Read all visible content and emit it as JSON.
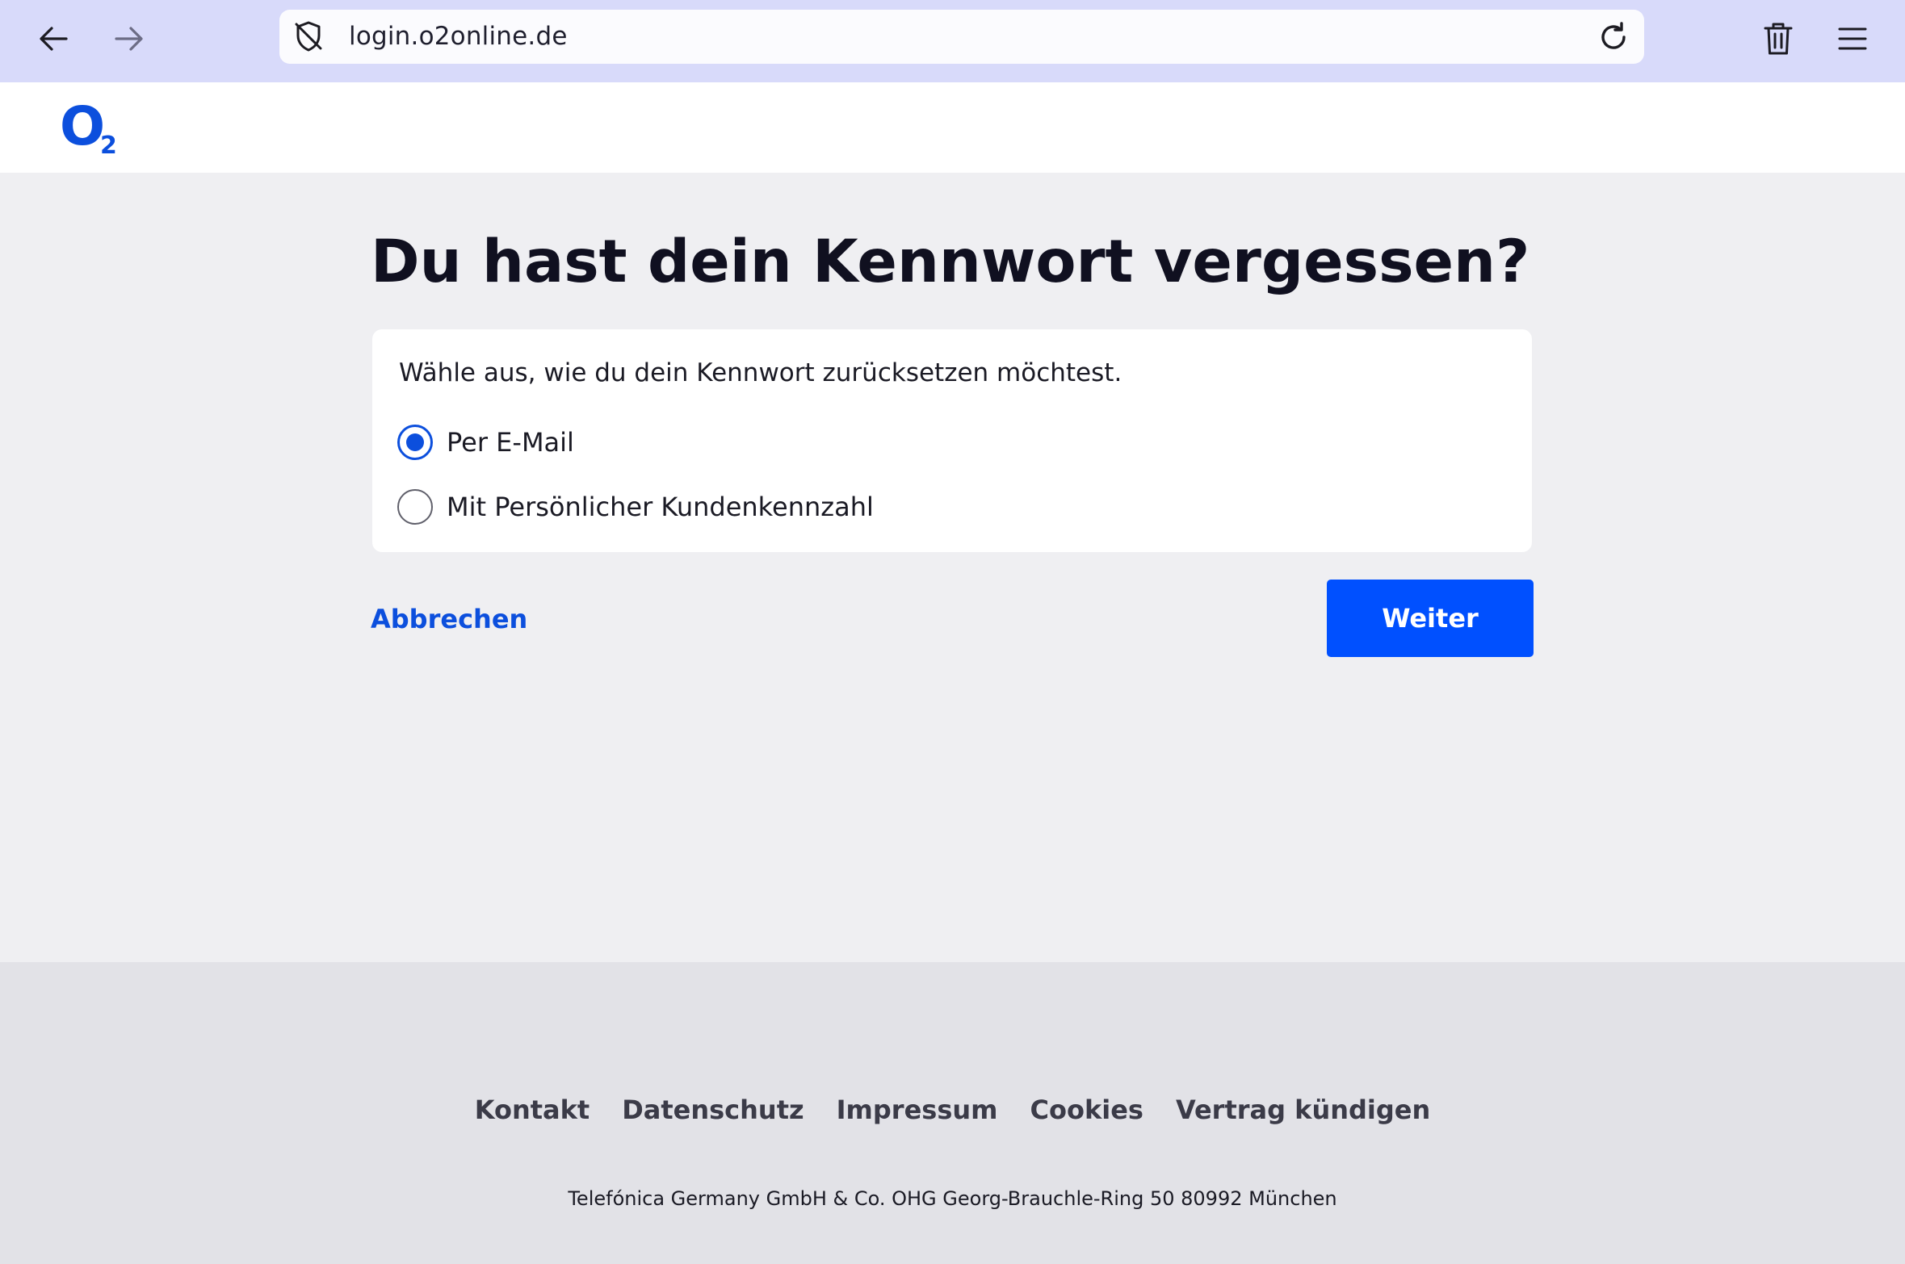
{
  "browser": {
    "url": "login.o2online.de",
    "icons": [
      "back-arrow-icon",
      "forward-arrow-icon",
      "tracking-shield-icon",
      "reload-icon",
      "trash-icon",
      "hamburger-menu-icon"
    ]
  },
  "header": {
    "logo": {
      "letter": "O",
      "subscript": "2"
    }
  },
  "main": {
    "title": "Du hast dein Kennwort vergessen?",
    "instruction": "Wähle aus, wie du dein Kennwort zurücksetzen möchtest.",
    "options": [
      {
        "label": "Per E-Mail",
        "selected": true
      },
      {
        "label": "Mit Persönlicher Kundenkennzahl",
        "selected": false
      }
    ],
    "cancel_label": "Abbrechen",
    "next_label": "Weiter"
  },
  "footer": {
    "links": [
      "Kontakt",
      "Datenschutz",
      "Impressum",
      "Cookies",
      "Vertrag kündigen"
    ],
    "address": "Telefónica Germany GmbH & Co. OHG Georg-Brauchle-Ring 50 80992 München"
  },
  "colors": {
    "brand_blue": "#0c4fdd",
    "button_blue": "#0050ff",
    "browser_bar": "#d8dafa",
    "page_bg": "#efeff2",
    "footer_bg": "#e2e2e7"
  }
}
